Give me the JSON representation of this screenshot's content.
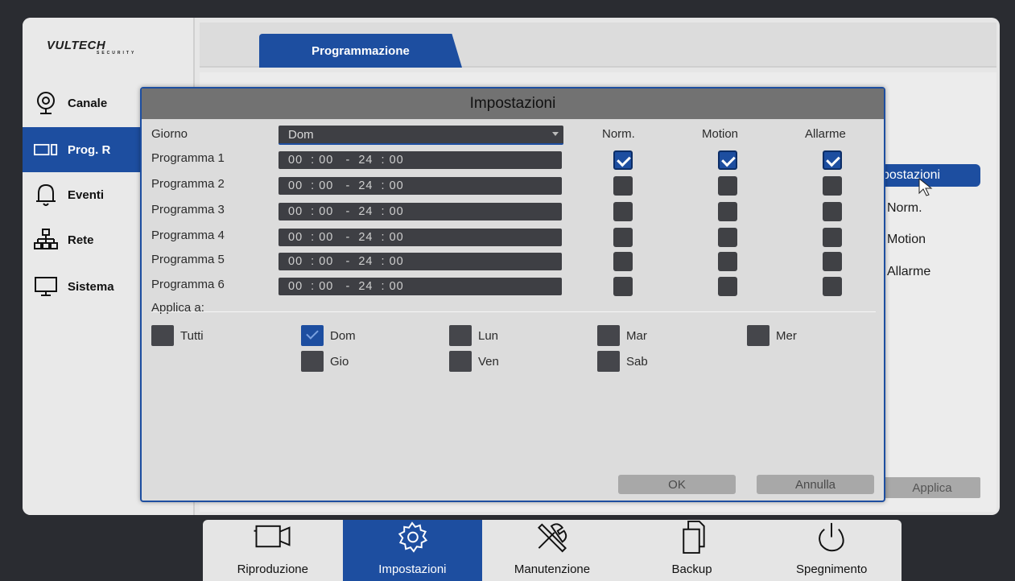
{
  "logo": {
    "brand": "VULTECH",
    "tagline": "SECURITY"
  },
  "sidebar": {
    "items": [
      {
        "label": "Canale",
        "icon": "camera-icon"
      },
      {
        "label": "Prog. R",
        "icon": "record-icon"
      },
      {
        "label": "Eventi",
        "icon": "bell-icon"
      },
      {
        "label": "Rete",
        "icon": "network-icon"
      },
      {
        "label": "Sistema",
        "icon": "monitor-icon"
      }
    ],
    "active_index": 1
  },
  "header": {
    "tab": "Programmazione"
  },
  "background_panel": {
    "subtab": "postazioni",
    "labels": [
      "Norm.",
      "Motion",
      "Allarme"
    ],
    "apply_button": "Applica"
  },
  "dialog": {
    "title": "Impostazioni",
    "giorno_label": "Giorno",
    "giorno_value": "Dom",
    "columns": [
      "Norm.",
      "Motion",
      "Allarme"
    ],
    "programs": [
      {
        "label": "Programma 1",
        "start_h": "00",
        "start_m": "00",
        "end_h": "24",
        "end_m": "00",
        "norm": true,
        "motion": true,
        "allarme": true,
        "time": "00  : 00   -  24  : 00"
      },
      {
        "label": "Programma 2",
        "start_h": "00",
        "start_m": "00",
        "end_h": "24",
        "end_m": "00",
        "norm": false,
        "motion": false,
        "allarme": false,
        "time": "00  : 00   -  24  : 00"
      },
      {
        "label": "Programma 3",
        "start_h": "00",
        "start_m": "00",
        "end_h": "24",
        "end_m": "00",
        "norm": false,
        "motion": false,
        "allarme": false,
        "time": "00  : 00   -  24  : 00"
      },
      {
        "label": "Programma 4",
        "start_h": "00",
        "start_m": "00",
        "end_h": "24",
        "end_m": "00",
        "norm": false,
        "motion": false,
        "allarme": false,
        "time": "00  : 00   -  24  : 00"
      },
      {
        "label": "Programma 5",
        "start_h": "00",
        "start_m": "00",
        "end_h": "24",
        "end_m": "00",
        "norm": false,
        "motion": false,
        "allarme": false,
        "time": "00  : 00   -  24  : 00"
      },
      {
        "label": "Programma 6",
        "start_h": "00",
        "start_m": "00",
        "end_h": "24",
        "end_m": "00",
        "norm": false,
        "motion": false,
        "allarme": false,
        "time": "00  : 00   -  24  : 00"
      }
    ],
    "applica_label": "Applica a:",
    "days": [
      {
        "label": "Tutti",
        "checked": false
      },
      {
        "label": "Dom",
        "checked": true
      },
      {
        "label": "Lun",
        "checked": false
      },
      {
        "label": "Mar",
        "checked": false
      },
      {
        "label": "Mer",
        "checked": false
      },
      {
        "label": "Gio",
        "checked": false
      },
      {
        "label": "Ven",
        "checked": false
      },
      {
        "label": "Sab",
        "checked": false
      }
    ],
    "ok_label": "OK",
    "cancel_label": "Annulla"
  },
  "bottom_nav": {
    "items": [
      {
        "label": "Riproduzione",
        "icon": "video-camera-icon"
      },
      {
        "label": "Impostazioni",
        "icon": "gear-icon"
      },
      {
        "label": "Manutenzione",
        "icon": "tools-icon"
      },
      {
        "label": "Backup",
        "icon": "copy-icon"
      },
      {
        "label": "Spegnimento",
        "icon": "power-icon"
      }
    ],
    "active_index": 1
  },
  "colors": {
    "accent": "#1d4ea0",
    "field": "#3e3f44",
    "dialog_bg": "#dcdcdc"
  }
}
